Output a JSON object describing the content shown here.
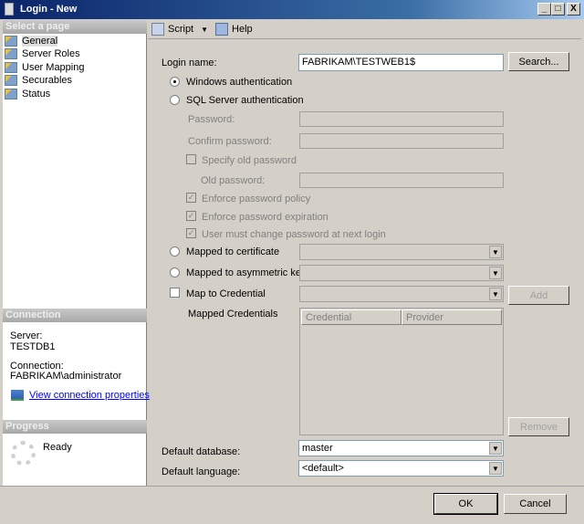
{
  "window": {
    "title": "Login - New",
    "minimize": "_",
    "maximize": "□",
    "close": "X"
  },
  "sidebar": {
    "header": "Select a page",
    "items": [
      {
        "label": "General",
        "selected": true
      },
      {
        "label": "Server Roles"
      },
      {
        "label": "User Mapping"
      },
      {
        "label": "Securables"
      },
      {
        "label": "Status"
      }
    ]
  },
  "connection": {
    "header": "Connection",
    "server_label": "Server:",
    "server": "TESTDB1",
    "connection_label": "Connection:",
    "connection": "FABRIKAM\\administrator",
    "link": "View connection properties"
  },
  "progress": {
    "header": "Progress",
    "status": "Ready"
  },
  "toolbar": {
    "script": "Script",
    "help": "Help"
  },
  "form": {
    "login_name_label": "Login name:",
    "login_name": "FABRIKAM\\TESTWEB1$",
    "search": "Search...",
    "windows_auth": "Windows authentication",
    "sql_auth": "SQL Server authentication",
    "password": "Password:",
    "confirm_password": "Confirm password:",
    "specify_old": "Specify old password",
    "old_password": "Old password:",
    "enforce_policy": "Enforce password policy",
    "enforce_expiration": "Enforce password expiration",
    "must_change": "User must change password at next login",
    "mapped_cert": "Mapped to certificate",
    "mapped_asym": "Mapped to asymmetric key",
    "map_credential": "Map to Credential",
    "add": "Add",
    "mapped_credentials": "Mapped Credentials",
    "grid_columns": [
      "Credential",
      "Provider"
    ],
    "remove": "Remove",
    "default_db_label": "Default database:",
    "default_db": "master",
    "default_lang_label": "Default language:",
    "default_lang": "<default>"
  },
  "footer": {
    "ok": "OK",
    "cancel": "Cancel"
  }
}
